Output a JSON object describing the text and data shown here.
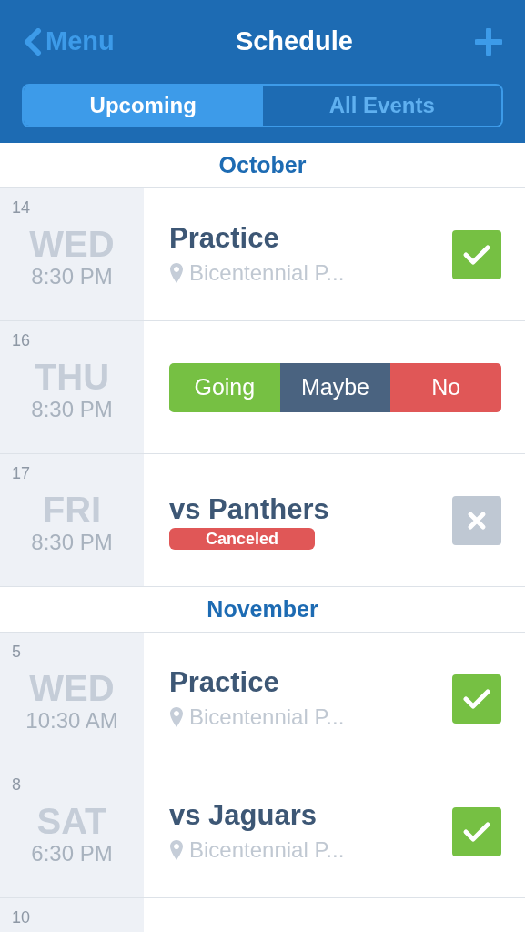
{
  "header": {
    "back_label": "Menu",
    "title": "Schedule",
    "tabs": [
      {
        "label": "Upcoming",
        "selected": true
      },
      {
        "label": "All Events",
        "selected": false
      }
    ]
  },
  "months": [
    {
      "name": "October",
      "events": [
        {
          "day": "14",
          "weekday": "WED",
          "time": "8:30 PM",
          "title": "Practice",
          "location": "Bicentennial P...",
          "kind": "status",
          "checked": true
        },
        {
          "day": "16",
          "weekday": "THU",
          "time": "8:30 PM",
          "kind": "rsvp",
          "options": [
            "Going",
            "Maybe",
            "No"
          ]
        },
        {
          "day": "17",
          "weekday": "FRI",
          "time": "8:30 PM",
          "title": "vs Panthers",
          "badge": "Canceled",
          "kind": "status",
          "checked": false
        }
      ]
    },
    {
      "name": "November",
      "events": [
        {
          "day": "5",
          "weekday": "WED",
          "time": "10:30 AM",
          "title": "Practice",
          "location": "Bicentennial P...",
          "kind": "status",
          "checked": true
        },
        {
          "day": "8",
          "weekday": "SAT",
          "time": "6:30 PM",
          "title": "vs Jaguars",
          "location": "Bicentennial P...",
          "kind": "status",
          "checked": true
        },
        {
          "day": "10",
          "kind": "partial"
        }
      ]
    }
  ]
}
